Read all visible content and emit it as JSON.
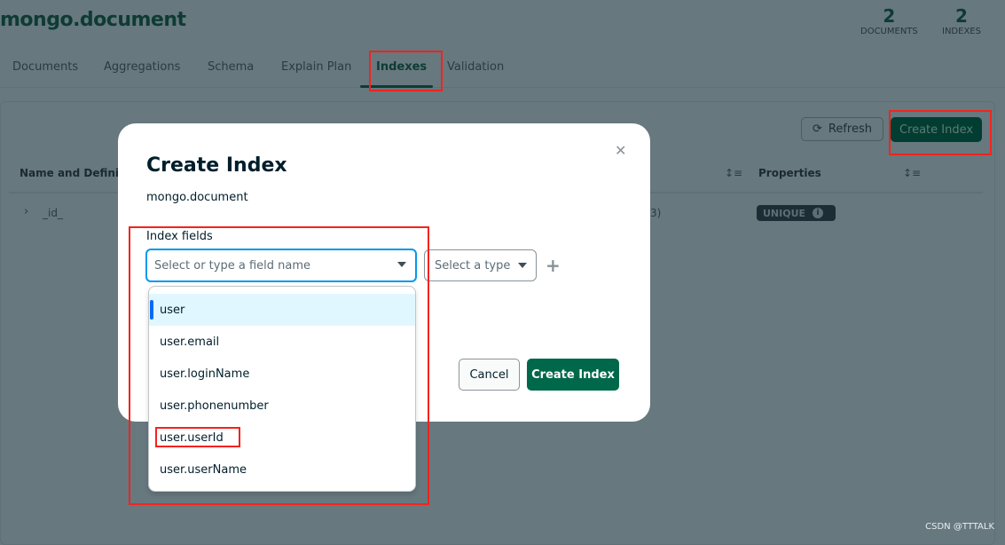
{
  "header": {
    "title": "mongo.document",
    "stats": [
      {
        "value": "2",
        "label": "DOCUMENTS"
      },
      {
        "value": "2",
        "label": "INDEXES"
      }
    ]
  },
  "tabs": [
    {
      "label": "Documents"
    },
    {
      "label": "Aggregations"
    },
    {
      "label": "Schema"
    },
    {
      "label": "Explain Plan"
    },
    {
      "label": "Indexes",
      "active": true
    },
    {
      "label": "Validation"
    }
  ],
  "toolbar": {
    "refresh": "Refresh",
    "create_index": "Create Index"
  },
  "table": {
    "headers": [
      "Name and Definit",
      "Properties"
    ],
    "rows": [
      {
        "name": "_id_",
        "partial": "3)",
        "badge": "UNIQUE"
      }
    ]
  },
  "modal": {
    "title": "Create Index",
    "namespace": "mongo.document",
    "fields_label": "Index fields",
    "field_placeholder": "Select or type a field name",
    "type_placeholder": "Select a type",
    "options": [
      "user",
      "user.email",
      "user.loginName",
      "user.phonenumber",
      "user.userId",
      "user.userName"
    ],
    "cancel": "Cancel",
    "create": "Create Index"
  },
  "watermark": "CSDN @TTTALK",
  "colors": {
    "accent": "#00684a",
    "highlight": "#f5231d",
    "focus": "#0498ec"
  }
}
